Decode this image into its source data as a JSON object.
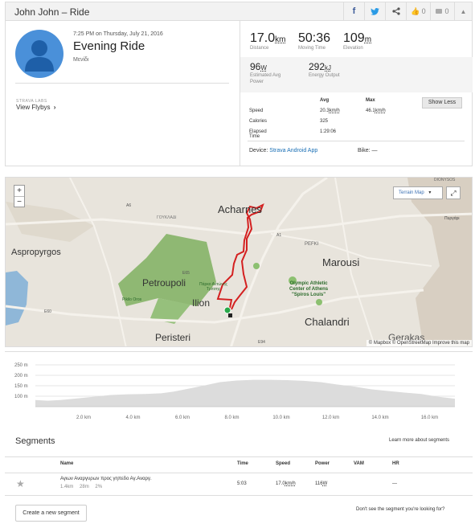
{
  "header": {
    "title": "John John – Ride",
    "share": {
      "facebook": "f",
      "twitter": "t",
      "share": "share"
    },
    "kudos_count": "0",
    "comment_count": "0"
  },
  "activity": {
    "date_line": "7:25 PM on Thursday, July 21, 2016",
    "title": "Evening Ride",
    "subtitle": "Μενίδι",
    "labs_label": "STRAVA LABS",
    "flyby_label": "View Flybys",
    "flyby_chevron": "›"
  },
  "stats": {
    "distance": {
      "value": "17.0",
      "unit": "km",
      "label": "Distance"
    },
    "moving_time": {
      "value": "50:36",
      "label": "Moving Time"
    },
    "elevation": {
      "value": "109",
      "unit": "m",
      "label": "Elevation"
    },
    "avg_power": {
      "value": "96",
      "unit": "W",
      "label1": "Estimated Avg",
      "label2": "Power"
    },
    "energy": {
      "value": "292",
      "unit": "kJ",
      "label": "Energy Output"
    }
  },
  "details": {
    "col_avg": "Avg",
    "col_max": "Max",
    "show_less": "Show Less",
    "rows": [
      {
        "label": "Speed",
        "avg": "20.3",
        "avg_unit": "km/h",
        "max": "46.1",
        "max_unit": "km/h"
      },
      {
        "label": "Calories",
        "avg": "325",
        "avg_unit": "",
        "max": "",
        "max_unit": ""
      },
      {
        "label": "Elapsed Time",
        "avg": "1:29:06",
        "avg_unit": "",
        "max": "",
        "max_unit": ""
      }
    ],
    "device_label": "Device:",
    "device_value": "Strava Android App",
    "bike_label": "Bike:",
    "bike_value": "—"
  },
  "map": {
    "zoom_in": "+",
    "zoom_out": "−",
    "terrain_label": "Terrain Map",
    "terrain_caret": "▾",
    "fullscreen": "⤢",
    "labels": {
      "acharnes": "Acharnes",
      "aspropyrgos": "Aspropyrgos",
      "petroupoli": "Petroupoli",
      "marousi": "Marousi",
      "ilion": "Ilion",
      "peristeri": "Peristeri",
      "chalandri": "Chalandri",
      "gerakas": "Gerakas",
      "pefki": "PEFKI",
      "olympic1": "Olympic Athletic",
      "olympic2": "Center of Athens",
      "olympic3": "\"Spiros Louis\"",
      "park1": "Πάρκο Αντώνης",
      "park2": "Τρίτσης",
      "pikilo": "Pikilo Oros",
      "dionysos": "DIONYSOS",
      "pyrgari": "Πυργάρι",
      "goukladi": "ΓΟΥΚΛΑΔΙ",
      "a6": "A6",
      "a1": "A1",
      "e60": "E60",
      "e65": "E65",
      "e94": "E94"
    },
    "attribution": "© Mapbox © OpenStreetMap Improve this map"
  },
  "elevation_chart": {
    "y_ticks": [
      "250 m",
      "200 m",
      "150 m",
      "100 m"
    ],
    "x_ticks": [
      "2.0 km",
      "4.0 km",
      "6.0 km",
      "8.0 km",
      "10.0 km",
      "12.0 km",
      "14.0 km",
      "16.0 km"
    ],
    "fill_color": "#dcdcdc"
  },
  "segments": {
    "title": "Segments",
    "learn_more": "Learn more about segments",
    "headers": {
      "name": "Name",
      "time": "Time",
      "speed": "Speed",
      "power": "Power",
      "vam": "VAM",
      "hr": "HR"
    },
    "rows": [
      {
        "star": "★",
        "name": "Αγιων Αναργυρων προς γηπεδο Αγ.Αναργ.",
        "dist": "1.4km",
        "elev": "28m",
        "grade": "2%",
        "time": "5:03",
        "speed": "17.0",
        "speed_unit": "km/h",
        "power": "116",
        "power_unit": "W",
        "vam": "",
        "hr": "—"
      }
    ],
    "create_button": "Create a new segment",
    "dont_see": "Don't see the segment you're looking for?"
  }
}
